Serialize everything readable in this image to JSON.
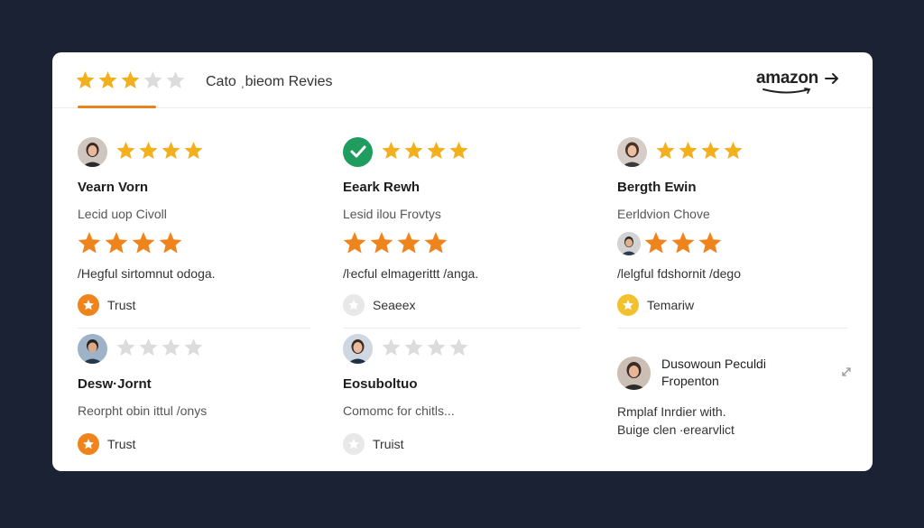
{
  "header": {
    "title": "Cato ˌbieom Revies",
    "rating": 3,
    "brand": "amazon",
    "brand_arrow": "→"
  },
  "colors": {
    "accent": "#e8821f",
    "star_gold": "#f2b01e",
    "star_orange": "#f0841c",
    "star_empty": "#dcdcdc",
    "verified_green": "#1f9d5e"
  },
  "reviews": [
    {
      "name": "Vearn Vorn",
      "subtitle": "Lecid uop Civoll",
      "quote": "/Hegful sirtomnut odoga.",
      "badge": "Trust",
      "badge_icon": "orange-star-badge-icon"
    },
    {
      "name": "Eeark Rewh",
      "subtitle": "Lesid ilou Frovtys",
      "quote": "/ŀecful elmagerittt /anga.",
      "badge": "Seaeex",
      "badge_icon": "gray-star-badge-icon"
    },
    {
      "name": "Bergth Ewin",
      "subtitle": "Eerldvion Chove",
      "quote": "/lelgful fdshornit /dego",
      "badge": "Temariw",
      "badge_icon": "yellow-star-badge-icon"
    },
    {
      "name": "Desw·Jornt",
      "subtitle": "Reorpht obin ittul /onys",
      "badge": "Trust",
      "badge_icon": "orange-star-badge-icon"
    },
    {
      "name": "Eosuboltuo",
      "subtitle": "Comomc for chitls...",
      "badge": "Truist",
      "badge_icon": "gray-star-badge-icon"
    }
  ],
  "special": {
    "name_line1": "Dusowoun Peculdi",
    "name_line2": "Fropenton",
    "text_line1": "Rmplaf Inrdier with.",
    "text_line2": "Buige clen ∙erearvlict",
    "more_icon": "expand-icon"
  }
}
